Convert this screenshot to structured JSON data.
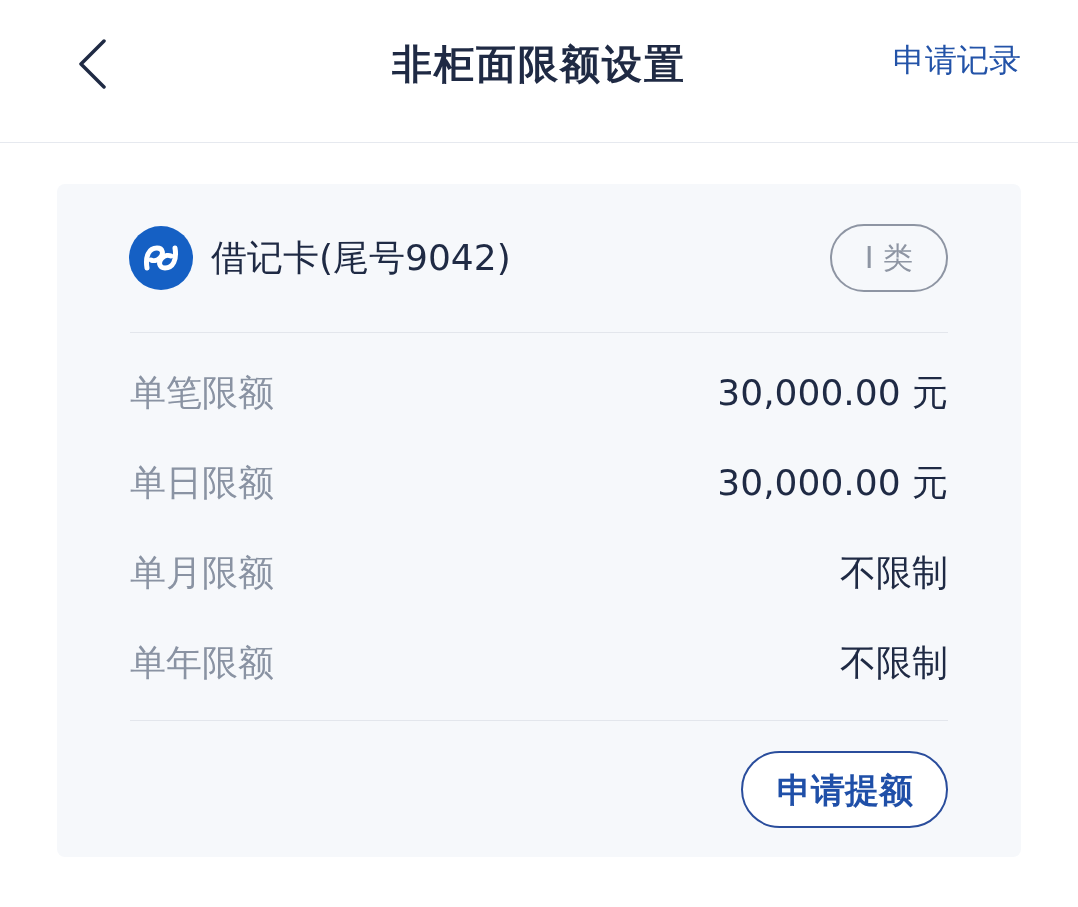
{
  "nav": {
    "title": "非柜面限额设置",
    "action": "申请记录"
  },
  "card": {
    "name": "借记卡(尾号9042)",
    "badge": "I 类",
    "rows": [
      {
        "label": "单笔限额",
        "value": "30,000.00 元"
      },
      {
        "label": "单日限额",
        "value": "30,000.00 元"
      },
      {
        "label": "单月限额",
        "value": "不限制"
      },
      {
        "label": "单年限额",
        "value": "不限制"
      }
    ],
    "button": "申请提额"
  }
}
